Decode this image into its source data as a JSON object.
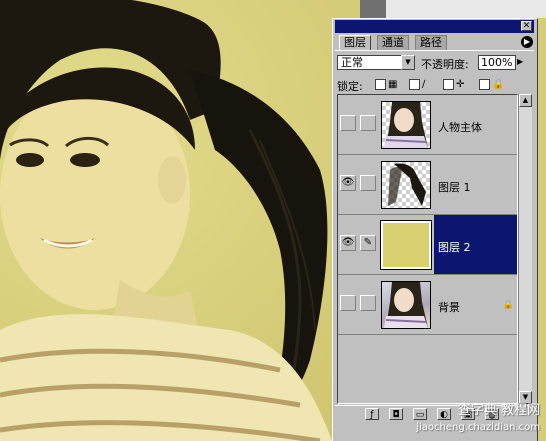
{
  "palette": {
    "tabs": [
      {
        "label": "图层",
        "active": true
      },
      {
        "label": "通道",
        "active": false
      },
      {
        "label": "路径",
        "active": false
      }
    ],
    "blend_mode": "正常",
    "opacity_label": "不透明度:",
    "opacity_value": "100%",
    "lock_label": "锁定:",
    "layers": [
      {
        "name": "人物主体",
        "visible": false,
        "selected": false,
        "thumbnail": "checker-photo",
        "locked": false
      },
      {
        "name": "图层 1",
        "visible": true,
        "selected": false,
        "thumbnail": "checker-photo",
        "locked": false
      },
      {
        "name": "图层 2",
        "visible": true,
        "selected": true,
        "thumbnail": "solid-color",
        "locked": false
      },
      {
        "name": "背景",
        "visible": false,
        "selected": false,
        "thumbnail": "photo",
        "locked": true
      }
    ],
    "colors": {
      "title_bar": "#0a1670",
      "selected_row": "#0a1670",
      "layer2_fill": "#d8cf6e",
      "canvas_tint": "#d6cd7a"
    }
  },
  "watermark": {
    "line1": "查字典 教程网",
    "line2": "jiaocheng.chazidian.com"
  }
}
